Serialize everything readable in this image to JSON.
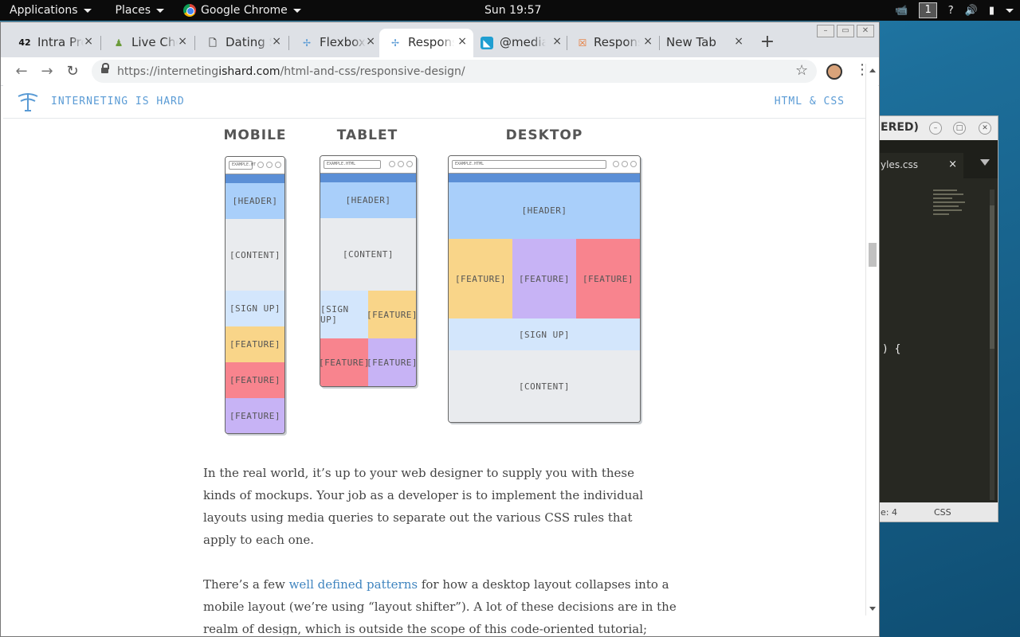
{
  "panel": {
    "applications": "Applications",
    "places": "Places",
    "app_name": "Google Chrome",
    "clock": "Sun 19:57",
    "workspace": "1",
    "tray_help": "?"
  },
  "editor": {
    "title": "ERED)",
    "tab_label": "yles.css",
    "tab_close": "×",
    "code_text": ") {",
    "status_left": "e: 4",
    "status_right": "CSS"
  },
  "browser": {
    "tabs": [
      {
        "label": "Intra Profile",
        "fav": "42",
        "fav_color": "#111"
      },
      {
        "label": "Live Chess",
        "fav": "♟",
        "fav_color": "#6b9b3a"
      },
      {
        "label": "Dating Sim",
        "fav": "🗋",
        "fav_color": "#555"
      },
      {
        "label": "Flexbox",
        "fav": "✢",
        "fav_color": "#5a9bd5"
      },
      {
        "label": "Responsive Design",
        "fav": "✢",
        "fav_color": "#5a9bd5"
      },
      {
        "label": "@media",
        "fav": "◣",
        "fav_color": "#1f9ed1"
      },
      {
        "label": "Responsive",
        "fav": "☒",
        "fav_color": "#e8742e"
      },
      {
        "label": "New Tab",
        "fav": "",
        "fav_color": "#555"
      }
    ],
    "tab_close": "×",
    "new_tab": "+",
    "url_scheme_host": "https://interneting",
    "url_host_strong": "ishard.com",
    "url_path": "/html-and-css/responsive-design/"
  },
  "site": {
    "name": "INTERNETING IS HARD",
    "nav_link": "HTML & CSS"
  },
  "mockups": {
    "mobile": {
      "label": "MOBILE",
      "url": "EXAMPLE.HT"
    },
    "tablet": {
      "label": "TABLET",
      "url": "EXAMPLE.HTML"
    },
    "desktop": {
      "label": "DESKTOP",
      "url": "EXAMPLE.HTML"
    },
    "blocks": {
      "header": "[HEADER]",
      "content": "[CONTENT]",
      "signup": "[SIGN UP]",
      "feature": "[FEATURE]"
    }
  },
  "article": {
    "p1": "In the real world, it’s up to your web designer to supply you with these kinds of mockups. Your job as a developer is to implement the individual layouts using media queries to separate out the various CSS rules that apply to each one.",
    "p2_before": "There’s a few ",
    "p2_link": "well defined patterns",
    "p2_after": " for how a desktop layout collapses into a mobile layout (we’re using “layout shifter”). A lot of these decisions are in the realm of design, which is outside the scope of this code-oriented tutorial;"
  },
  "colors": {
    "header": "#a9cffa",
    "content": "#e9ebee",
    "signup": "#d3e6fc",
    "feature_yellow": "#f9d589",
    "feature_red": "#f8848e",
    "feature_purple": "#c7b3f5",
    "accent": "#5b8fd6",
    "link": "#3f84bf"
  }
}
